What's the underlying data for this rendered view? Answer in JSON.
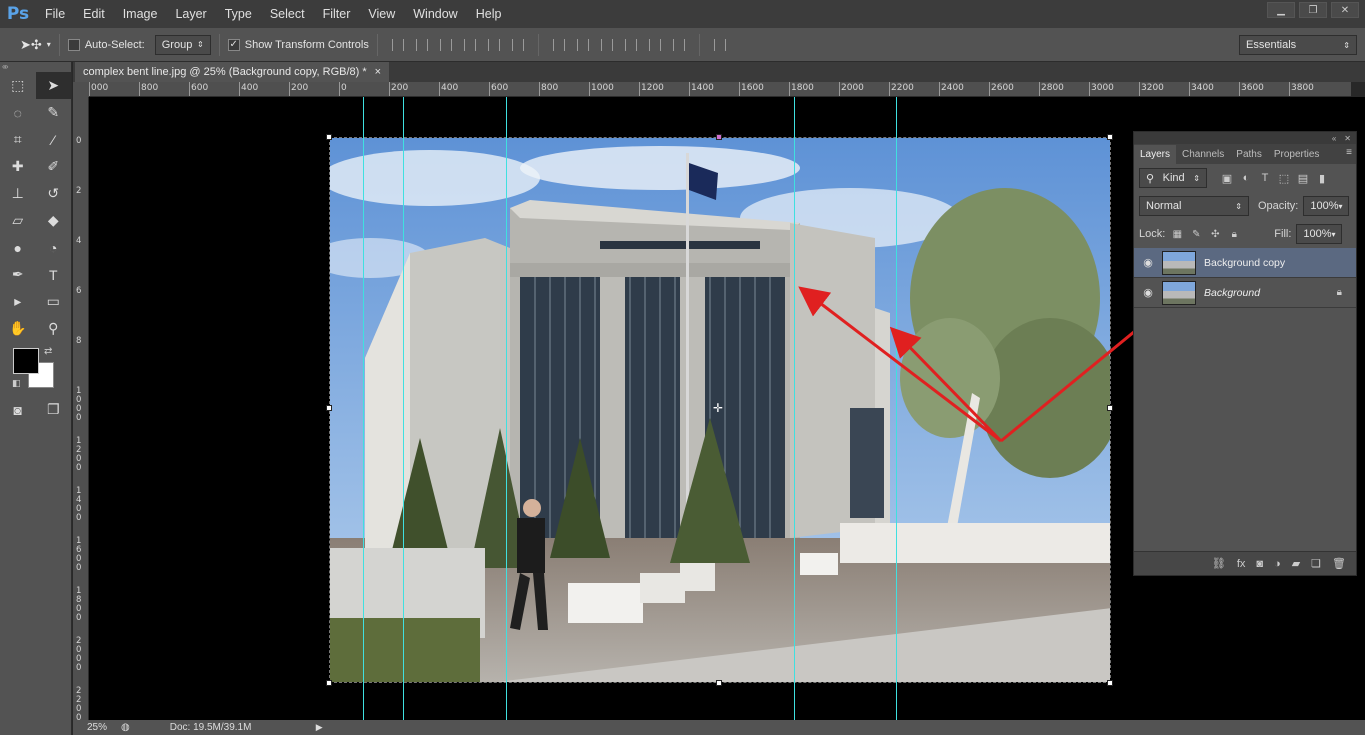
{
  "app": {
    "logo": "Ps"
  },
  "menu": [
    "File",
    "Edit",
    "Image",
    "Layer",
    "Type",
    "Select",
    "Filter",
    "View",
    "Window",
    "Help"
  ],
  "options": {
    "move_tool_icon": "move-icon",
    "auto_select_label": "Auto-Select:",
    "auto_select_value": "Group",
    "show_transform_label": "Show Transform Controls",
    "workspace": "Essentials"
  },
  "document": {
    "tab_title": "complex bent line.jpg @ 25% (Background copy, RGB/8) *",
    "close_glyph": "×"
  },
  "ruler": {
    "top_labels": [
      "000",
      "800",
      "600",
      "400",
      "200",
      "0",
      "200",
      "400",
      "600",
      "800",
      "1000",
      "1200",
      "1400",
      "1600",
      "1800",
      "2000",
      "2200",
      "2400",
      "2600",
      "2800",
      "3000",
      "3200",
      "3400",
      "3600",
      "3800"
    ],
    "left_labels": [
      "0",
      "2",
      "4",
      "6",
      "8",
      "1000",
      "1200",
      "1400",
      "1600",
      "1800",
      "2000",
      "2200"
    ]
  },
  "status": {
    "zoom": "25%",
    "doc": "Doc: 19.5M/39.1M"
  },
  "layers_panel": {
    "tabs": [
      "Layers",
      "Channels",
      "Paths",
      "Properties"
    ],
    "filter_kind": "Kind",
    "blend_mode": "Normal",
    "opacity_label": "Opacity:",
    "opacity_value": "100%",
    "lock_label": "Lock:",
    "fill_label": "Fill:",
    "fill_value": "100%",
    "layers": [
      {
        "name": "Background copy",
        "selected": true
      },
      {
        "name": "Background",
        "selected": false
      }
    ]
  },
  "colors": {
    "accent_guides": "#3fe0e0",
    "arrow_red": "#e02020",
    "foreground": "#000000",
    "background": "#ffffff"
  }
}
